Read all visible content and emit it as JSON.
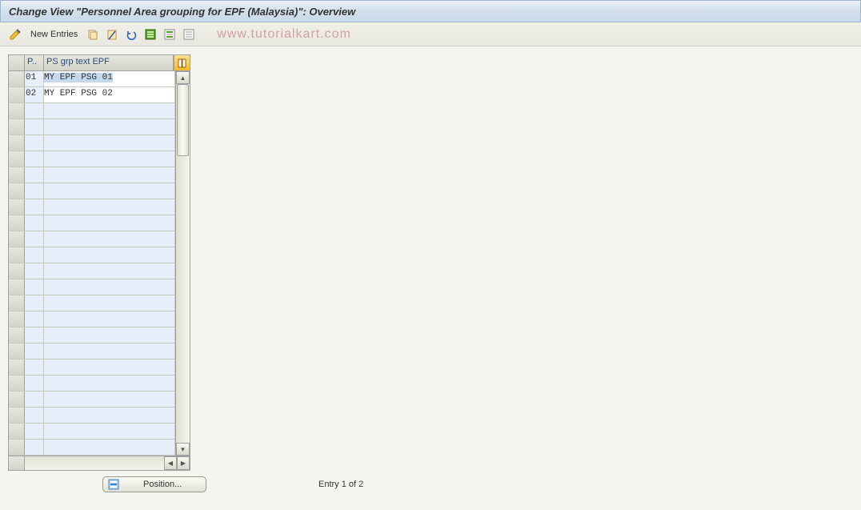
{
  "title": "Change View \"Personnel Area grouping for EPF (Malaysia)\": Overview",
  "toolbar": {
    "new_entries": "New Entries"
  },
  "watermark": "www.tutorialkart.com",
  "table": {
    "columns": {
      "p": "P..",
      "text": "PS grp text EPF"
    },
    "rows": [
      {
        "p": "01",
        "text": "MY EPF PSG 01",
        "selected": true
      },
      {
        "p": "02",
        "text": "MY EPF PSG 02",
        "selected": false
      }
    ],
    "empty_row_count": 22
  },
  "footer": {
    "position_label": "Position...",
    "entry_text": "Entry 1 of 2"
  }
}
